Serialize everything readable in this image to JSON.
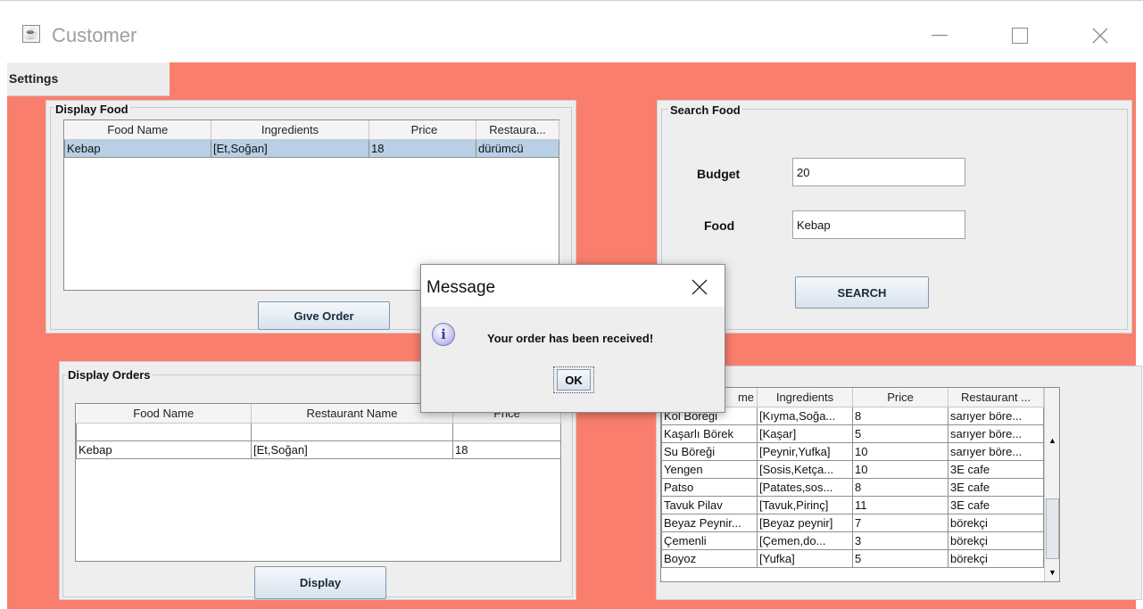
{
  "window": {
    "title": "Customer",
    "icon": "java-coffee-icon"
  },
  "menu": {
    "settings": "Settings"
  },
  "display_food": {
    "legend": "Display Food",
    "columns": [
      "Food Name",
      "Ingredients",
      "Price",
      "Restaura..."
    ],
    "rows": [
      [
        "Kebap",
        "[Et,Soğan]",
        "18",
        "dürümcü"
      ]
    ],
    "button": "Gıve Order"
  },
  "search_food": {
    "legend": "Search Food",
    "budget_label": "Budget",
    "budget_value": "20",
    "food_label": "Food",
    "food_value": "Kebap",
    "button": "SEARCH"
  },
  "display_orders": {
    "legend": "Display Orders",
    "columns": [
      "Food Name",
      "Restaurant Name",
      "Price"
    ],
    "rows": [
      [
        "",
        "",
        ""
      ],
      [
        "Kebap",
        "[Et,Soğan]",
        "18"
      ]
    ],
    "button": "Display"
  },
  "menu_table": {
    "columns": [
      "me",
      "Ingredients",
      "Price",
      "Restaurant ..."
    ],
    "rows": [
      [
        "Kol Böreği",
        "[Kıyma,Soğa...",
        "8",
        "sarıyer böre..."
      ],
      [
        "Kaşarlı Börek",
        "[Kaşar]",
        "5",
        "sarıyer böre..."
      ],
      [
        "Su Böreği",
        "[Peynir,Yufka]",
        "10",
        "sarıyer böre..."
      ],
      [
        "Yengen",
        "[Sosis,Ketça...",
        "10",
        "3E cafe"
      ],
      [
        "Patso",
        "[Patates,sos...",
        "8",
        "3E cafe"
      ],
      [
        "Tavuk Pilav",
        "[Tavuk,Pirinç]",
        "11",
        "3E cafe"
      ],
      [
        "Beyaz Peynir...",
        "[Beyaz peynir]",
        "7",
        "börekçi"
      ],
      [
        "Çemenli",
        "[Çemen,do...",
        "3",
        "börekçi"
      ],
      [
        "Boyoz",
        "[Yufka]",
        "5",
        "börekçi"
      ]
    ]
  },
  "dialog": {
    "title": "Message",
    "message": "Your order has been received!",
    "ok": "OK"
  },
  "colors": {
    "background": "#fa7e6e",
    "panel": "#eeeeee",
    "selection": "#b8cfe5"
  }
}
